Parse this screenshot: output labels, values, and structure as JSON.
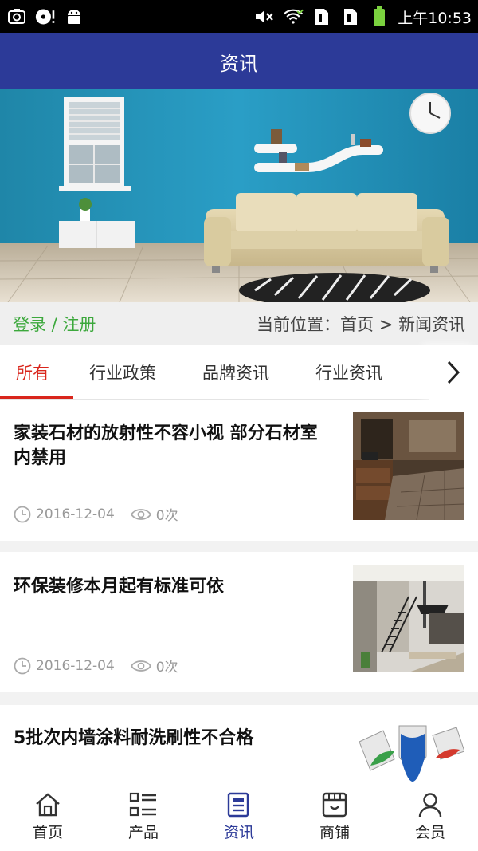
{
  "status_bar": {
    "time": "上午10:53",
    "icons": [
      "screenshot-icon",
      "music-disc-icon",
      "android-icon",
      "mute-icon",
      "wifi-icon",
      "sim1-icon",
      "sim2-icon",
      "battery-icon"
    ]
  },
  "header": {
    "title": "资讯"
  },
  "crumb_bar": {
    "login_label": "登录 / 注册",
    "breadcrumb": "当前位置：首页 > 新闻资讯"
  },
  "tabs": [
    {
      "label": "所有",
      "active": true
    },
    {
      "label": "行业政策",
      "active": false
    },
    {
      "label": "品牌资讯",
      "active": false
    },
    {
      "label": "行业资讯",
      "active": false
    }
  ],
  "articles": [
    {
      "title": "家装石材的放射性不容小视 部分石材室内禁用",
      "date": "2016-12-04",
      "views": "0次"
    },
    {
      "title": "环保装修本月起有标准可依",
      "date": "2016-12-04",
      "views": "0次"
    },
    {
      "title": "5批次内墙涂料耐洗刷性不合格",
      "date": "",
      "views": ""
    }
  ],
  "bottom_nav": [
    {
      "label": "首页",
      "icon": "home-icon",
      "active": false
    },
    {
      "label": "产品",
      "icon": "product-list-icon",
      "active": false
    },
    {
      "label": "资讯",
      "icon": "news-icon",
      "active": true
    },
    {
      "label": "商铺",
      "icon": "store-icon",
      "active": false
    },
    {
      "label": "会员",
      "icon": "member-icon",
      "active": false
    }
  ],
  "colors": {
    "brand": "#2c3a98",
    "tab_active": "#d9261c",
    "login_green": "#3ca83c"
  }
}
